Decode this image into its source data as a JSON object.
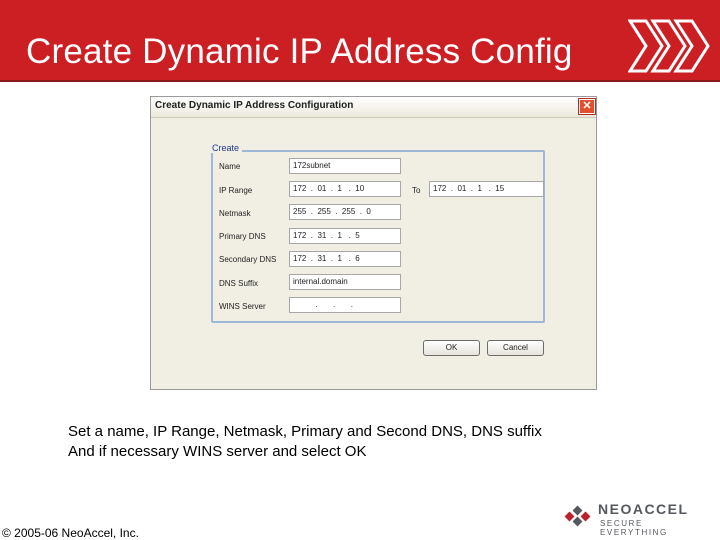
{
  "slide": {
    "title": "Create Dynamic IP Address Config",
    "caption_line1": "Set a name, IP Range, Netmask, Primary and Second DNS, DNS suffix",
    "caption_line2": "And if necessary WINS server and select OK",
    "copyright": "© 2005-06 NeoAccel, Inc.",
    "accent_color": "#cc1f24"
  },
  "dialog": {
    "title": "Create Dynamic IP Address Configuration",
    "close_label": "✕",
    "group_label": "Create",
    "fields": {
      "name": {
        "label": "Name",
        "value": "172subnet"
      },
      "ip_range": {
        "label": "IP Range",
        "from": "172  .  01  .  1   .  10",
        "to_label": "To",
        "to": "172  .  01  .  1   .  15"
      },
      "netmask": {
        "label": "Netmask",
        "value": "255  .  255  .  255  .  0"
      },
      "primary_dns": {
        "label": "Primary DNS",
        "value": "172  .  31  .  1   .  5"
      },
      "secondary_dns": {
        "label": "Secondary DNS",
        "value": "172  .  31  .  1   .  6"
      },
      "dns_suffix": {
        "label": "DNS Suffix",
        "value": "internal.domain"
      },
      "wins_server": {
        "label": "WINS Server",
        "value": "          .       .       ."
      }
    },
    "ok_label": "OK",
    "cancel_label": "Cancel"
  },
  "logo": {
    "name": "NEOACCEL",
    "tagline": "SECURE EVERYTHING"
  }
}
